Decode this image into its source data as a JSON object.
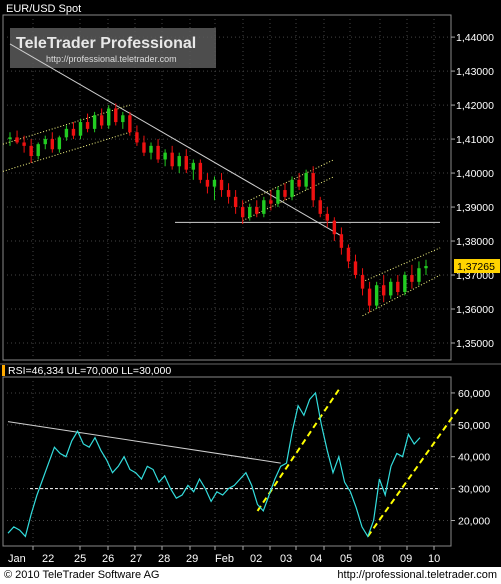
{
  "chart_data": [
    {
      "type": "candlestick",
      "title": "EUR/USD Spot",
      "ylim": [
        1.345,
        1.4465
      ],
      "yticks": [
        "1,44000",
        "1,43000",
        "1,42000",
        "1,41000",
        "1,40000",
        "1,39000",
        "1,38000",
        "1,37000",
        "1,36000",
        "1,35000"
      ],
      "last_price_label": "1,37265",
      "last_price": 1.37265,
      "horizontal_line": 1.3855,
      "grid": true,
      "colors": {
        "up": "#22cc22",
        "down": "#ee1111",
        "trend": "#ffff88",
        "line": "#cfcfcf",
        "background": "#000000",
        "grid": "#444444"
      },
      "watermark": {
        "title": "TeleTrader Professional",
        "subtitle": "http://professional.teletrader.com"
      },
      "candles": [
        [
          1.41,
          1.412,
          1.408,
          1.4105
        ],
        [
          1.4105,
          1.4125,
          1.4085,
          1.409
        ],
        [
          1.409,
          1.411,
          1.406,
          1.408
        ],
        [
          1.408,
          1.41,
          1.403,
          1.405
        ],
        [
          1.405,
          1.409,
          1.404,
          1.4085
        ],
        [
          1.4085,
          1.411,
          1.407,
          1.41
        ],
        [
          1.41,
          1.412,
          1.406,
          1.407
        ],
        [
          1.407,
          1.411,
          1.406,
          1.4105
        ],
        [
          1.4105,
          1.414,
          1.4095,
          1.413
        ],
        [
          1.413,
          1.415,
          1.41,
          1.411
        ],
        [
          1.411,
          1.416,
          1.41,
          1.415
        ],
        [
          1.415,
          1.4175,
          1.412,
          1.413
        ],
        [
          1.413,
          1.418,
          1.412,
          1.417
        ],
        [
          1.417,
          1.419,
          1.413,
          1.414
        ],
        [
          1.414,
          1.42,
          1.413,
          1.419
        ],
        [
          1.419,
          1.4205,
          1.414,
          1.415
        ],
        [
          1.415,
          1.418,
          1.413,
          1.417
        ],
        [
          1.417,
          1.418,
          1.411,
          1.412
        ],
        [
          1.412,
          1.414,
          1.408,
          1.409
        ],
        [
          1.409,
          1.411,
          1.405,
          1.406
        ],
        [
          1.406,
          1.409,
          1.404,
          1.408
        ],
        [
          1.408,
          1.41,
          1.403,
          1.404
        ],
        [
          1.404,
          1.407,
          1.402,
          1.406
        ],
        [
          1.406,
          1.408,
          1.401,
          1.402
        ],
        [
          1.402,
          1.406,
          1.4,
          1.405
        ],
        [
          1.405,
          1.407,
          1.4,
          1.401
        ],
        [
          1.401,
          1.404,
          1.398,
          1.403
        ],
        [
          1.403,
          1.404,
          1.397,
          1.398
        ],
        [
          1.398,
          1.4,
          1.394,
          1.396
        ],
        [
          1.396,
          1.399,
          1.392,
          1.398
        ],
        [
          1.398,
          1.4,
          1.393,
          1.395
        ],
        [
          1.395,
          1.397,
          1.391,
          1.393
        ],
        [
          1.393,
          1.395,
          1.388,
          1.39
        ],
        [
          1.39,
          1.392,
          1.385,
          1.387
        ],
        [
          1.387,
          1.391,
          1.386,
          1.39
        ],
        [
          1.39,
          1.392,
          1.387,
          1.388
        ],
        [
          1.388,
          1.393,
          1.387,
          1.392
        ],
        [
          1.392,
          1.395,
          1.389,
          1.391
        ],
        [
          1.391,
          1.396,
          1.39,
          1.395
        ],
        [
          1.395,
          1.397,
          1.392,
          1.393
        ],
        [
          1.393,
          1.399,
          1.392,
          1.398
        ],
        [
          1.398,
          1.4,
          1.395,
          1.396
        ],
        [
          1.396,
          1.401,
          1.395,
          1.4
        ],
        [
          1.4,
          1.402,
          1.39,
          1.392
        ],
        [
          1.392,
          1.393,
          1.387,
          1.388
        ],
        [
          1.388,
          1.39,
          1.384,
          1.386
        ],
        [
          1.386,
          1.387,
          1.38,
          1.382
        ],
        [
          1.382,
          1.384,
          1.376,
          1.378
        ],
        [
          1.378,
          1.379,
          1.372,
          1.374
        ],
        [
          1.374,
          1.376,
          1.369,
          1.37
        ],
        [
          1.37,
          1.372,
          1.364,
          1.366
        ],
        [
          1.366,
          1.368,
          1.359,
          1.361
        ],
        [
          1.361,
          1.368,
          1.36,
          1.367
        ],
        [
          1.367,
          1.37,
          1.362,
          1.364
        ],
        [
          1.364,
          1.369,
          1.363,
          1.368
        ],
        [
          1.368,
          1.37,
          1.364,
          1.365
        ],
        [
          1.365,
          1.371,
          1.364,
          1.37
        ],
        [
          1.37,
          1.373,
          1.366,
          1.368
        ],
        [
          1.368,
          1.374,
          1.367,
          1.372
        ],
        [
          1.372,
          1.3745,
          1.37,
          1.37265
        ]
      ],
      "trend_lines": [
        {
          "style": "solid",
          "color": "line",
          "from": [
            0,
            1.438
          ],
          "to": [
            47,
            1.3815
          ]
        },
        {
          "style": "dotted",
          "color": "trend",
          "from": [
            -1,
            1.4005
          ],
          "to": [
            17,
            1.412
          ]
        },
        {
          "style": "dotted",
          "color": "trend",
          "from": [
            -1,
            1.4085
          ],
          "to": [
            17,
            1.42
          ]
        },
        {
          "style": "dotted",
          "color": "trend",
          "from": [
            33,
            1.386
          ],
          "to": [
            46,
            1.399
          ]
        },
        {
          "style": "dotted",
          "color": "trend",
          "from": [
            33,
            1.391
          ],
          "to": [
            46,
            1.404
          ]
        },
        {
          "style": "dotted",
          "color": "trend",
          "from": [
            50,
            1.358
          ],
          "to": [
            61,
            1.37
          ]
        },
        {
          "style": "dotted",
          "color": "trend",
          "from": [
            50,
            1.368
          ],
          "to": [
            61,
            1.378
          ]
        }
      ]
    },
    {
      "type": "line",
      "title": "RSI=46,334  UL=70,000  LL=30,000",
      "ylim": [
        12,
        65
      ],
      "yticks": [
        "60,000",
        "50,000",
        "40,000",
        "30,000",
        "20,000"
      ],
      "horizontal_line": 30,
      "xlabels": [
        "Jan",
        "22",
        "25",
        "26",
        "27",
        "28",
        "29",
        "Feb",
        "02",
        "03",
        "04",
        "05",
        "08",
        "09",
        "10"
      ],
      "colors": {
        "rsi": "#33dddd",
        "trend": "#ffff00",
        "line": "#cfcfcf",
        "hline": "#ffffff"
      },
      "values": [
        16,
        18,
        17,
        15,
        22,
        28,
        33,
        38,
        43,
        41,
        40,
        45,
        48,
        44,
        43,
        46,
        42,
        39,
        35,
        37,
        40,
        36,
        35,
        33,
        37,
        36,
        32,
        34,
        30,
        27,
        28,
        31,
        29,
        33,
        30,
        26,
        29,
        28,
        30,
        31,
        33,
        35,
        31,
        25,
        23,
        28,
        33,
        37,
        38,
        48,
        56,
        53,
        58,
        60,
        50,
        42,
        35,
        40,
        32,
        29,
        24,
        18,
        15,
        20,
        33,
        28,
        37,
        41,
        40,
        47,
        44,
        46
      ],
      "trend_lines": [
        {
          "style": "solid",
          "color": "line",
          "from": [
            0,
            51
          ],
          "to": [
            47,
            38
          ]
        },
        {
          "style": "dashed",
          "color": "trend",
          "from": [
            43,
            23
          ],
          "to": [
            57,
            61
          ]
        },
        {
          "style": "dashed",
          "color": "trend",
          "from": [
            62,
            15
          ],
          "to": [
            75,
            55
          ]
        }
      ]
    }
  ],
  "footer": {
    "copyright": "© 2010 TeleTrader Software AG",
    "url": "http://professional.teletrader.com"
  }
}
